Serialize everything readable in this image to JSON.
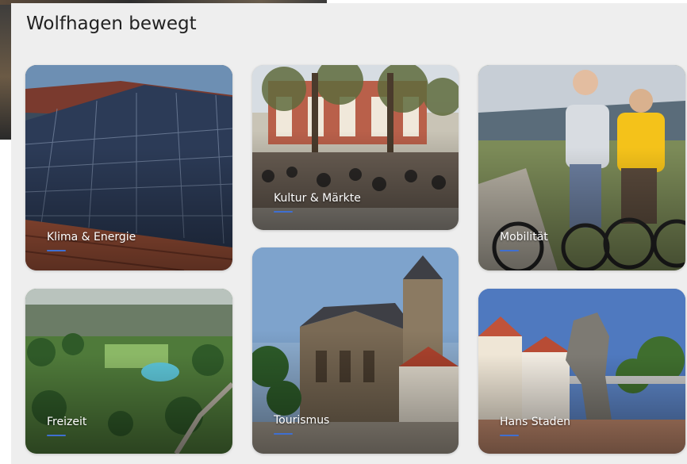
{
  "section": {
    "title": "Wolfhagen bewegt"
  },
  "tiles": [
    {
      "label": "Klima & Energie",
      "image": "solar-panels-on-roof"
    },
    {
      "label": "Kultur & Märkte",
      "image": "market-square-with-crowd"
    },
    {
      "label": "Mobilität",
      "image": "two-cyclists-with-e-bikes"
    },
    {
      "label": "Freizeit",
      "image": "aerial-park-with-pool"
    },
    {
      "label": "Tourismus",
      "image": "historic-church-tower"
    },
    {
      "label": "Hans Staden",
      "image": "hans-staden-statue"
    }
  ],
  "colors": {
    "panel_bg": "#eeeeee",
    "heading": "#222222",
    "accent_underline": "#3f6fd1"
  }
}
